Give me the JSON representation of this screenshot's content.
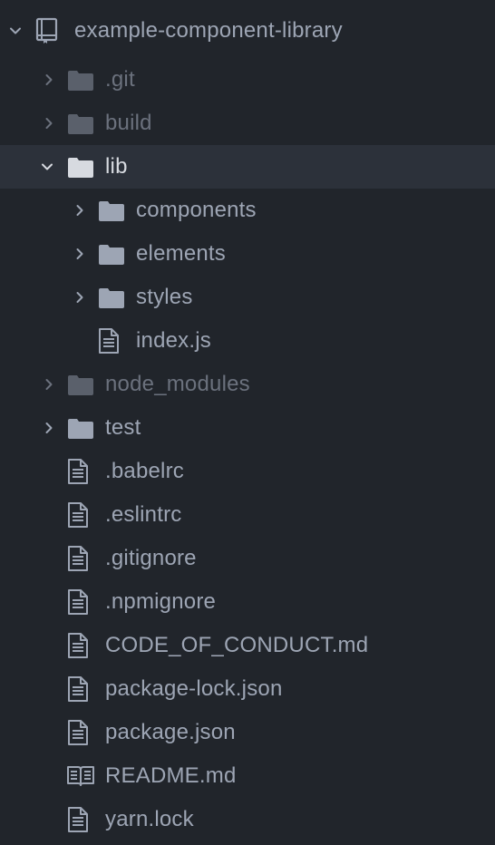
{
  "tree": {
    "root": {
      "label": "example-component-library",
      "expanded": true,
      "icon": "repo-icon"
    },
    "items": [
      {
        "label": ".git",
        "type": "folder",
        "expanded": false,
        "ignored": true
      },
      {
        "label": "build",
        "type": "folder",
        "expanded": false,
        "ignored": true
      },
      {
        "label": "lib",
        "type": "folder",
        "expanded": true,
        "selected": true
      },
      {
        "label": "components",
        "type": "folder",
        "expanded": false
      },
      {
        "label": "elements",
        "type": "folder",
        "expanded": false
      },
      {
        "label": "styles",
        "type": "folder",
        "expanded": false
      },
      {
        "label": "index.js",
        "type": "file"
      },
      {
        "label": "node_modules",
        "type": "folder",
        "expanded": false,
        "ignored": true
      },
      {
        "label": "test",
        "type": "folder",
        "expanded": false
      },
      {
        "label": ".babelrc",
        "type": "file"
      },
      {
        "label": ".eslintrc",
        "type": "file"
      },
      {
        "label": ".gitignore",
        "type": "file"
      },
      {
        "label": ".npmignore",
        "type": "file"
      },
      {
        "label": "CODE_OF_CONDUCT.md",
        "type": "file"
      },
      {
        "label": "package-lock.json",
        "type": "file"
      },
      {
        "label": "package.json",
        "type": "file"
      },
      {
        "label": "README.md",
        "type": "readme"
      },
      {
        "label": "yarn.lock",
        "type": "file"
      }
    ]
  },
  "colors": {
    "background": "#21252b",
    "selected_row": "#2c313a",
    "text": "#9da5b4",
    "text_bright": "#d7dae0",
    "text_ignored": "#6b717d",
    "folder": "#9da5b4",
    "folder_open": "#d7dae0"
  }
}
